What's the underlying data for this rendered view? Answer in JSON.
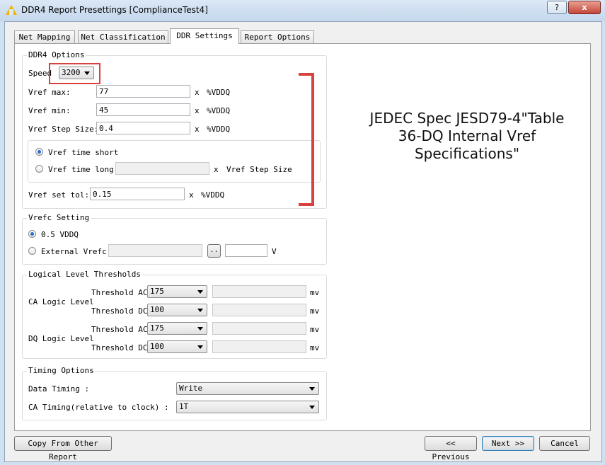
{
  "window": {
    "title": "DDR4 Report Presettings [ComplianceTest4]",
    "help_label": "?",
    "close_label": "x"
  },
  "tabs": [
    "Net Mapping",
    "Net Classification",
    "DDR Settings",
    "Report Options"
  ],
  "ddr4_options": {
    "legend": "DDR4 Options",
    "speed_label": "Speed",
    "speed_value": "3200",
    "vref_max": {
      "label": "Vref max:",
      "value": "77",
      "x": "x",
      "unit": "%VDDQ"
    },
    "vref_min": {
      "label": "Vref min:",
      "value": "45",
      "x": "x",
      "unit": "%VDDQ"
    },
    "vref_step": {
      "label": "Vref Step Size:",
      "value": "0.4",
      "x": "x",
      "unit": "%VDDQ"
    },
    "vref_time_short": "Vref time short",
    "vref_time_long": "Vref time long",
    "vref_time_long_value": "",
    "vref_time_long_x": "x",
    "vref_time_long_unit": "Vref Step Size",
    "vref_set_tol": {
      "label": "Vref set tol:",
      "value": "0.15",
      "x": "x",
      "unit": "%VDDQ"
    }
  },
  "vrefc": {
    "legend": "Vrefc Setting",
    "half_vddq": "0.5 VDDQ",
    "external": "External Vrefc",
    "browse": "..",
    "unit": "V"
  },
  "thresholds": {
    "legend": "Logical Level Thresholds",
    "ca_label": "CA Logic Level",
    "dq_label": "DQ Logic Level",
    "ac_label": "Threshold AC",
    "dc_label": "Threshold DC",
    "ca_ac": "175",
    "ca_dc": "100",
    "dq_ac": "175",
    "dq_dc": "100",
    "unit": "mv"
  },
  "timing": {
    "legend": "Timing Options",
    "data_label": "Data Timing :",
    "data_value": "Write",
    "ca_label": "CA Timing(relative to clock) :",
    "ca_value": "1T"
  },
  "annotation": "JEDEC Spec JESD79-4\"Table 36-DQ Internal Vref Specifications\"",
  "buttons": {
    "copy": "Copy From Other Report",
    "previous": "<< Previous",
    "next": "Next >>",
    "cancel": "Cancel"
  },
  "colors": {
    "highlight": "#d9413f",
    "accent": "#2a6bd6"
  }
}
